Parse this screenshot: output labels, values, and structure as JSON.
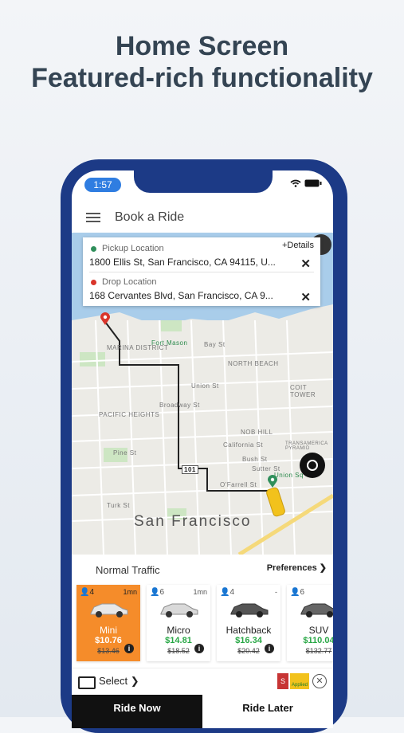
{
  "hero": {
    "line1": "Home Screen",
    "line2": "Featured-rich functionality"
  },
  "status_bar": {
    "time": "1:57"
  },
  "app_bar": {
    "title": "Book a Ride"
  },
  "location_card": {
    "details": "+Details",
    "pickup_label": "Pickup Location",
    "pickup_value": "1800 Ellis St, San Francisco, CA 94115, U...",
    "drop_label": "Drop Location",
    "drop_value": "168 Cervantes Blvd, San Francisco, CA 9..."
  },
  "map": {
    "city": "San Francisco",
    "labels": [
      "MARINA DISTRICT",
      "Fort Mason",
      "NORTH BEACH",
      "PACIFIC HEIGHTS",
      "NOB HILL",
      "COIT TOWER",
      "TRANSAMERICA PYRAMID",
      "Union Sq",
      "Bay St",
      "Union St",
      "Broadway St",
      "California St",
      "Bush St",
      "Sutter St",
      "O'Farrell St",
      "Pine St",
      "Turk St",
      "101"
    ]
  },
  "ride": {
    "traffic": "Normal Traffic",
    "preferences": "Preferences"
  },
  "cars": [
    {
      "seats": "4",
      "eta": "1mn",
      "name": "Mini",
      "price": "$10.76",
      "old_price": "$13.46"
    },
    {
      "seats": "6",
      "eta": "1mn",
      "name": "Micro",
      "price": "$14.81",
      "old_price": "$18.52"
    },
    {
      "seats": "4",
      "eta": "-",
      "name": "Hatchback",
      "price": "$16.34",
      "old_price": "$20.42"
    },
    {
      "seats": "6",
      "eta": "",
      "name": "SUV",
      "price": "$110.04",
      "old_price": "$132.77"
    }
  ],
  "payment": {
    "select": "Select",
    "badge_letter": "S",
    "applied": "Applied"
  },
  "actions": {
    "ride_now": "Ride Now",
    "ride_later": "Ride Later"
  },
  "colors": {
    "phone_frame": "#1c3a86",
    "selected_car": "#f58c2a",
    "price_green": "#28a745"
  }
}
